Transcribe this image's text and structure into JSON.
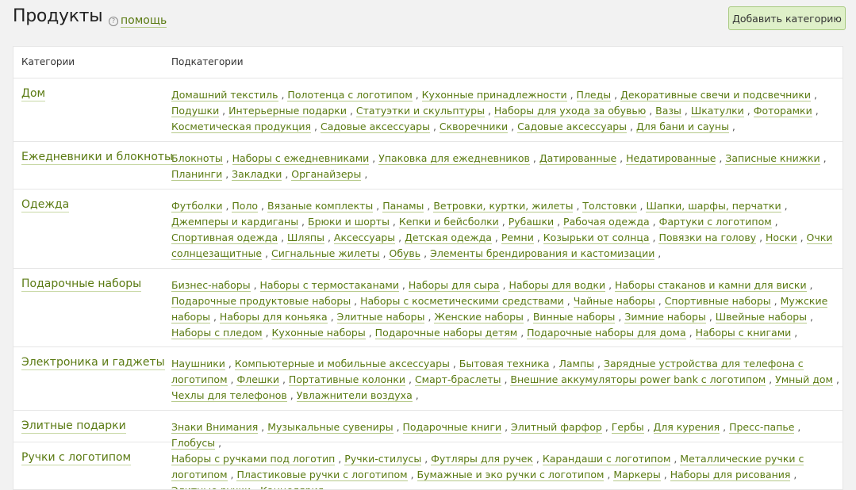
{
  "header": {
    "title": "Продукты",
    "help_label": "помощь",
    "add_button_label": "Добавить категорию"
  },
  "table": {
    "col_categories": "Категории",
    "col_subcategories": "Подкатегории",
    "rows": [
      {
        "category": "Дом",
        "subcategories": [
          "Домашний текстиль",
          "Полотенца с логотипом",
          "Кухонные принадлежности",
          "Пледы",
          "Декоративные свечи и подсвечники",
          "Подушки",
          "Интерьерные подарки",
          "Статуэтки и скульптуры",
          "Наборы для ухода за обувью",
          "Вазы",
          "Шкатулки",
          "Фоторамки",
          "Косметическая продукция",
          "Садовые аксессуары",
          "Скворечники",
          "Садовые аксессуары",
          "Для бани и сауны"
        ]
      },
      {
        "category": "Ежедневники и блокноты",
        "subcategories": [
          "Блокноты",
          "Наборы с ежедневниками",
          "Упаковка для ежедневников",
          "Датированные",
          "Недатированные",
          "Записные книжки",
          "Планинги",
          "Закладки",
          "Органайзеры"
        ]
      },
      {
        "category": "Одежда",
        "subcategories": [
          "Футболки",
          "Поло",
          "Вязаные комплекты",
          "Панамы",
          "Ветровки, куртки, жилеты",
          "Толстовки",
          "Шапки, шарфы, перчатки",
          "Джемперы и кардиганы",
          "Брюки и шорты",
          "Кепки и бейсболки",
          "Рубашки",
          "Рабочая одежда",
          "Фартуки с логотипом",
          "Спортивная одежда",
          "Шляпы",
          "Аксессуары",
          "Детская одежда",
          "Ремни",
          "Козырьки от солнца",
          "Повязки на голову",
          "Носки",
          "Очки солнцезащитные",
          "Сигнальные жилеты",
          "Обувь",
          "Элементы брендирования и кастомизации"
        ]
      },
      {
        "category": "Подарочные наборы",
        "subcategories": [
          "Бизнес-наборы",
          "Наборы с термостаканами",
          "Наборы для сыра",
          "Наборы для водки",
          "Наборы стаканов и камни для виски",
          "Подарочные продуктовые наборы",
          "Наборы с косметическими средствами",
          "Чайные наборы",
          "Спортивные наборы",
          "Мужские наборы",
          "Наборы для коньяка",
          "Элитные наборы",
          "Женские наборы",
          "Винные наборы",
          "Зимние наборы",
          "Швейные наборы",
          "Наборы с пледом",
          "Кухонные наборы",
          "Подарочные наборы детям",
          "Подарочные наборы для дома",
          "Наборы с книгами"
        ]
      },
      {
        "category": "Электроника и гаджеты",
        "subcategories": [
          "Наушники",
          "Компьютерные и мобильные аксессуары",
          "Бытовая техника",
          "Лампы",
          "Зарядные устройства для телефона с логотипом",
          "Флешки",
          "Портативные колонки",
          "Смарт-браслеты",
          "Внешние аккумуляторы power bank с логотипом",
          "Умный дом",
          "Чехлы для телефонов",
          "Увлажнители воздуха"
        ]
      },
      {
        "category": "Элитные подарки",
        "subcategories": [
          "Знаки Внимания",
          "Музыкальные сувениры",
          "Подарочные книги",
          "Элитный фарфор",
          "Гербы",
          "Для курения",
          "Пресс-папье",
          "Глобусы"
        ]
      },
      {
        "category": "Ручки с логотипом",
        "subcategories": [
          "Наборы с ручками под логотип",
          "Ручки-стилусы",
          "Футляры для ручек",
          "Карандаши с логотипом",
          "Металлические ручки с логотипом",
          "Пластиковые ручки с логотипом",
          "Бумажные и эко ручки с логотипом",
          "Маркеры",
          "Наборы для рисования",
          "Элитные ручки",
          "Канцелярия"
        ]
      }
    ]
  }
}
